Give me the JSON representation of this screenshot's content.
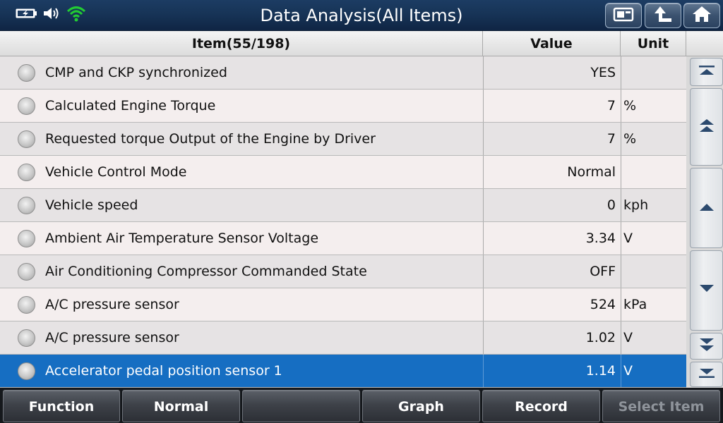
{
  "header": {
    "title": "Data Analysis(All Items)",
    "buttons": [
      {
        "name": "screenshot-button",
        "icon": "camera-icon"
      },
      {
        "name": "back-button",
        "icon": "return-arrow-icon"
      },
      {
        "name": "home-button",
        "icon": "home-icon"
      }
    ],
    "status_icons": [
      "battery-icon",
      "volume-icon",
      "wifi-icon"
    ]
  },
  "table": {
    "columns": {
      "item": "Item(55/198)",
      "value": "Value",
      "unit": "Unit"
    },
    "rows": [
      {
        "name": "CMP and CKP synchronized",
        "value": "YES",
        "unit": ""
      },
      {
        "name": "Calculated Engine Torque",
        "value": "7",
        "unit": "%"
      },
      {
        "name": "Requested torque Output of the Engine by Driver",
        "value": "7",
        "unit": "%"
      },
      {
        "name": "Vehicle Control Mode",
        "value": "Normal",
        "unit": ""
      },
      {
        "name": "Vehicle speed",
        "value": "0",
        "unit": "kph"
      },
      {
        "name": "Ambient Air Temperature Sensor Voltage",
        "value": "3.34",
        "unit": "V"
      },
      {
        "name": "Air Conditioning Compressor Commanded State",
        "value": "OFF",
        "unit": ""
      },
      {
        "name": "A/C pressure sensor",
        "value": "524",
        "unit": "kPa"
      },
      {
        "name": "A/C pressure sensor",
        "value": "1.02",
        "unit": "V"
      },
      {
        "name": "Accelerator pedal position sensor 1",
        "value": "1.14",
        "unit": "V",
        "selected": true
      }
    ]
  },
  "scroll_buttons": [
    "scroll-top-icon",
    "page-up-icon",
    "line-up-icon",
    "line-down-icon",
    "page-down-icon",
    "scroll-bottom-icon"
  ],
  "toolbar": {
    "function_label": "Function",
    "normal_label": "Normal",
    "empty_label": "",
    "graph_label": "Graph",
    "record_label": "Record",
    "select_item_label": "Select Item"
  },
  "colors": {
    "title_bar": "#173457",
    "selected_row": "#166ec2",
    "row_even": "#e6e3e4",
    "row_odd": "#f4eeee",
    "wifi": "#22cc33"
  }
}
